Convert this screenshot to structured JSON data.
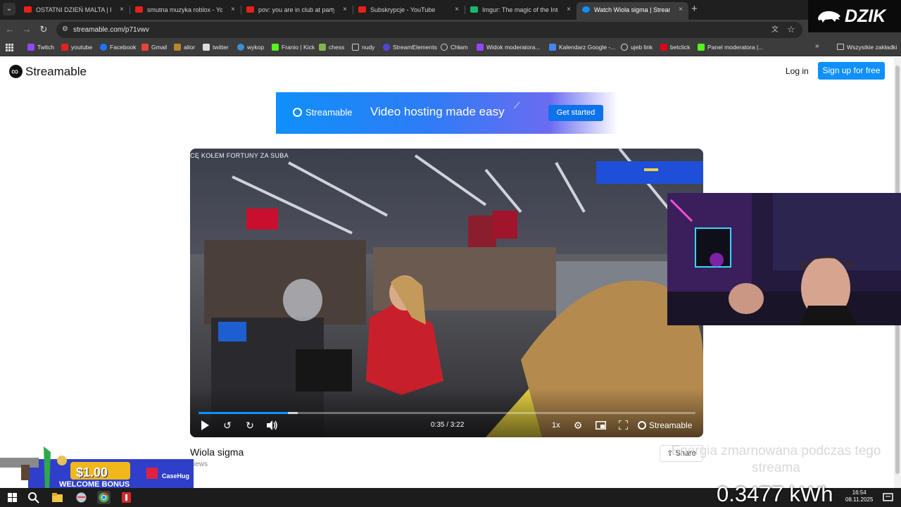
{
  "tabs": [
    {
      "label": "OSTATNI DZIEŃ MALTA | KONG",
      "icon": "youtube-icon"
    },
    {
      "label": "smutna muzyka roblox - YouTube",
      "icon": "youtube-icon"
    },
    {
      "label": "pov: you are in club at party wit",
      "icon": "youtube-icon"
    },
    {
      "label": "Subskrypcje - YouTube",
      "icon": "youtube-icon"
    },
    {
      "label": "Imgur: The magic of the Internet",
      "icon": "imgur-icon"
    },
    {
      "label": "Watch Wiola sigma | Streamable",
      "icon": "streamable-icon",
      "active": true
    }
  ],
  "tab_close": "×",
  "new_tab": "+",
  "address": {
    "url": "streamable.com/p71vwv"
  },
  "bookmarks": [
    {
      "label": "Twitch",
      "color": "#9146ff"
    },
    {
      "label": "youtube",
      "color": "#e62117"
    },
    {
      "label": "Facebook",
      "color": "#1877f2"
    },
    {
      "label": "Gmail",
      "color": "#ea4335"
    },
    {
      "label": "alior",
      "color": "#b8862b"
    },
    {
      "label": "twitter",
      "color": "#dddddd"
    },
    {
      "label": "wykop",
      "color": "#3b8fd1"
    },
    {
      "label": "Franio | Kick",
      "color": "#53fc18"
    },
    {
      "label": "chess",
      "color": "#81b64c"
    },
    {
      "label": "nudy",
      "color": "#cccccc"
    },
    {
      "label": "StreamElements",
      "color": "#5245de"
    },
    {
      "label": "Chłam",
      "color": "#cccccc"
    },
    {
      "label": "Widok moderatora...",
      "color": "#9146ff"
    },
    {
      "label": "Kalendarz Google -...",
      "color": "#4285f4"
    },
    {
      "label": "ujeb link",
      "color": "#dddddd"
    },
    {
      "label": "betclick",
      "color": "#e2001a"
    },
    {
      "label": "Panel moderatora |...",
      "color": "#53fc18"
    }
  ],
  "bookmarks_more": "»",
  "bookmarks_all": "Wszystkie zakładki",
  "overlay_brand": "DZIK",
  "site": {
    "logo": "Streamable",
    "login": "Log in",
    "signup": "Sign up for free"
  },
  "banner": {
    "brand": "Streamable",
    "tagline": "Video hosting made easy",
    "cta": "Get started"
  },
  "video": {
    "caption": "CĘ KOŁEM FORTUNY ZA SUBA",
    "time": "0:35 / 3:22",
    "speed": "1x",
    "brand": "Streamable",
    "progress": 0.18,
    "buffered": 0.2,
    "title": "Wiola sigma",
    "views": "views",
    "share": "Share"
  },
  "stream": {
    "note": "Energia zmarnowana podczas tego streama",
    "kwh": "0.3477 kWh"
  },
  "ad": {
    "amount": "$1.00",
    "welcome": "WELCOME BONUS",
    "brand": "CaseHug"
  },
  "taskbar": {
    "time": "16:54",
    "date": "08.11.2025"
  }
}
